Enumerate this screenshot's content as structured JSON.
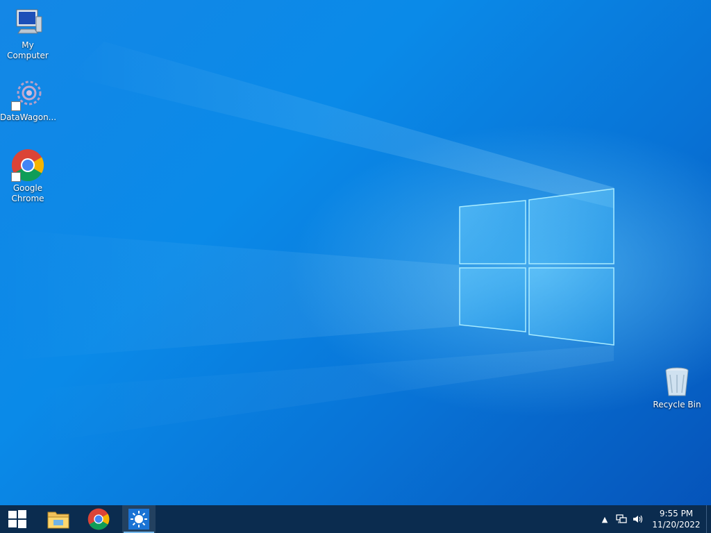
{
  "desktop": {
    "icons": [
      {
        "label": "My Computer"
      },
      {
        "label": "DataWagon..."
      },
      {
        "label": "Google\nChrome"
      },
      {
        "label": "Recycle Bin"
      }
    ]
  },
  "taskbar": {
    "start_icon": "windows-logo-icon",
    "pinned": [
      {
        "name": "file-explorer-icon"
      },
      {
        "name": "chrome-icon"
      },
      {
        "name": "app-sun-icon"
      }
    ],
    "tray": {
      "overflow_icon": "chevron-up-icon",
      "network_icon": "network-icon",
      "volume_icon": "volume-icon",
      "time": "9:55 PM",
      "date": "11/20/2022"
    }
  },
  "colors": {
    "taskbar": "#0b2c4f",
    "desktop_primary": "#0a8ae8",
    "active_indicator": "#76b9ed"
  }
}
